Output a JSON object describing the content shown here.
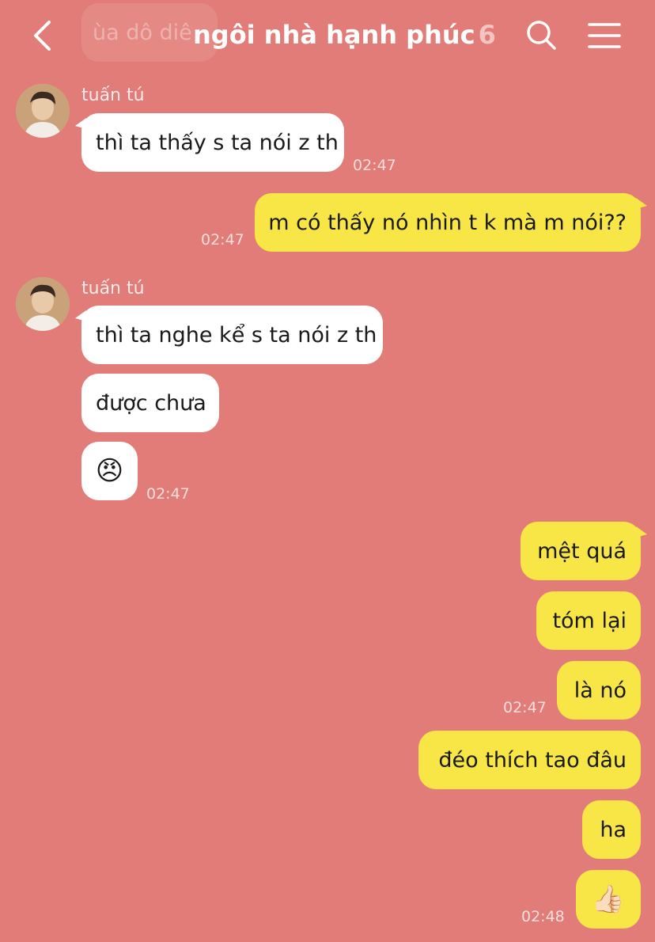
{
  "header": {
    "title": "ngôi nhà hạnh phúc",
    "member_count": "6",
    "preview_text": "ùa dô diê"
  },
  "messages": [
    {
      "sender": "tuấn tú",
      "text": "thì ta thấy s ta nói z th",
      "time": "02:47"
    },
    {
      "text": "m có thấy nó nhìn t k mà m nói??",
      "time": "02:47"
    },
    {
      "sender": "tuấn tú",
      "text": "thì ta nghe kể s ta nói z th"
    },
    {
      "text": "được chưa"
    },
    {
      "emoji": "😠",
      "time": "02:47"
    },
    {
      "text": "mệt quá"
    },
    {
      "text": "tóm lại"
    },
    {
      "text": "là nó",
      "time": "02:47"
    },
    {
      "text": "đéo thích tao đâu"
    },
    {
      "text": "ha"
    },
    {
      "emoji": "👍🏻",
      "time": "02:48"
    }
  ],
  "colors": {
    "background": "#e27c78",
    "incoming_bubble": "#ffffff",
    "outgoing_bubble": "#f7e645"
  },
  "icons": {
    "back": "chevron-left-icon",
    "search": "search-icon",
    "menu": "hamburger-menu-icon"
  }
}
